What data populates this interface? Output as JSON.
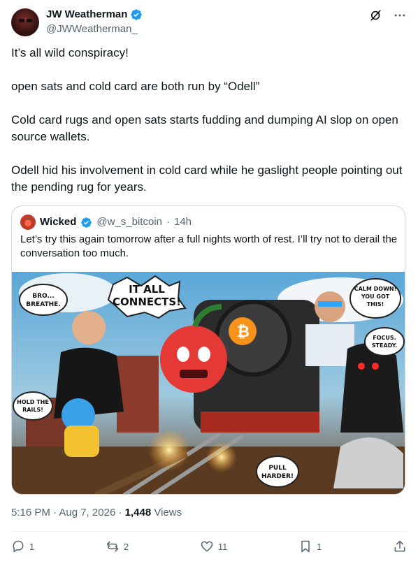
{
  "author": {
    "name": "JW Weatherman",
    "handle": "@JWWeatherman_"
  },
  "post": {
    "paragraphs": [
      "It’s all wild conspiracy!",
      "open sats and cold card are both run by “Odell”",
      "Cold card rugs and open sats starts fudding and dumping AI slop on open source wallets.",
      "Odell hid his involvement in cold card while he gaslight people pointing out the pending rug for years."
    ]
  },
  "quote": {
    "name": "Wicked",
    "handle": "@w_s_bitcoin",
    "separator": "·",
    "time": "14h",
    "text": "Let’s try this again tomorrow after a full nights worth of rest. I’ll try not to derail the conversation too much.",
    "image_captions": {
      "bro": [
        "BRO...",
        "BREATHE."
      ],
      "connects": [
        "IT ALL",
        "CONNECTS!"
      ],
      "calm": [
        "CALM DOWN!",
        "YOU GOT",
        "THIS!"
      ],
      "focus": [
        "FOCUS.",
        "STEADY."
      ],
      "hold": [
        "HOLD THE",
        "RAILS!"
      ],
      "pull": [
        "PULL",
        "HARDER!"
      ]
    }
  },
  "meta": {
    "time": "5:16 PM",
    "separator": "·",
    "date": "Aug 7, 2026",
    "separator2": "·",
    "views_count": "1,448",
    "views_label": "Views"
  },
  "actions": {
    "replies": "1",
    "reposts": "2",
    "likes": "11",
    "bookmarks": "1"
  },
  "colors": {
    "verified": "#1d9bf0",
    "text": "#0f1419",
    "muted": "#536471",
    "border": "#cfd9de"
  }
}
